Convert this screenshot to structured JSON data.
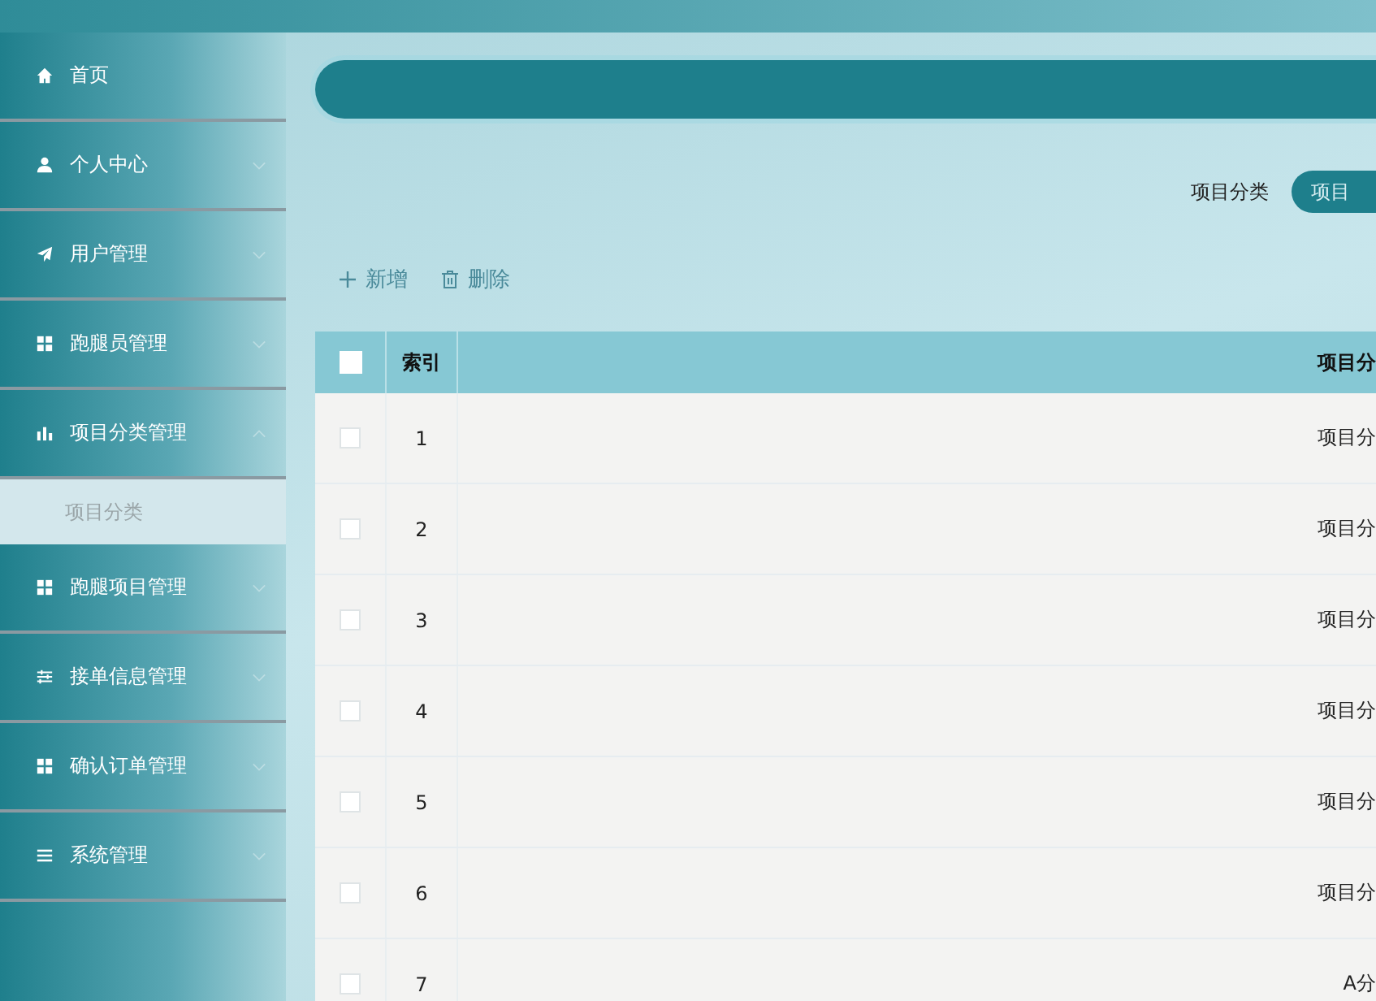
{
  "sidebar": {
    "items": [
      {
        "label": "首页"
      },
      {
        "label": "个人中心",
        "expanded": false
      },
      {
        "label": "用户管理",
        "expanded": false
      },
      {
        "label": "跑腿员管理",
        "expanded": false
      },
      {
        "label": "项目分类管理",
        "expanded": true,
        "children": [
          {
            "label": "项目分类",
            "selected": true
          }
        ]
      },
      {
        "label": "跑腿项目管理",
        "expanded": false
      },
      {
        "label": "接单信息管理",
        "expanded": false
      },
      {
        "label": "确认订单管理",
        "expanded": false
      },
      {
        "label": "系统管理",
        "expanded": false
      }
    ]
  },
  "search": {
    "label": "项目分类",
    "placeholder": "项目"
  },
  "toolbar": {
    "buttons": [
      {
        "label": "新增",
        "kind": "add"
      },
      {
        "label": "删除",
        "kind": "delete"
      }
    ]
  },
  "table": {
    "header_checked": false,
    "columns": [
      "索引",
      "项目分"
    ],
    "rows": [
      {
        "checked": false,
        "cells": [
          "1",
          "项目分"
        ]
      },
      {
        "checked": false,
        "cells": [
          "2",
          "项目分"
        ]
      },
      {
        "checked": false,
        "cells": [
          "3",
          "项目分"
        ]
      },
      {
        "checked": false,
        "cells": [
          "4",
          "项目分"
        ]
      },
      {
        "checked": false,
        "cells": [
          "5",
          "项目分"
        ]
      },
      {
        "checked": false,
        "cells": [
          "6",
          "项目分"
        ]
      },
      {
        "checked": false,
        "cells": [
          "7",
          "A分"
        ]
      }
    ]
  }
}
